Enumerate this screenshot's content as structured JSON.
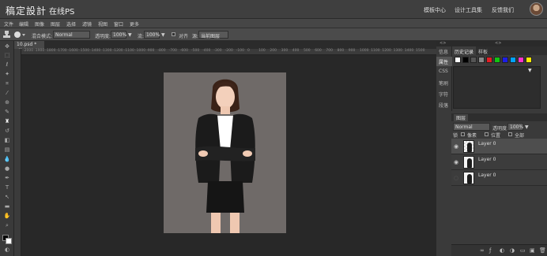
{
  "topbar": {
    "brand": "稿定設計",
    "subtitle": "在线PS",
    "links": [
      "模板中心",
      "设计工具集",
      "反馈我们"
    ]
  },
  "menu": [
    "文件",
    "编辑",
    "图像",
    "图层",
    "选择",
    "滤镜",
    "视图",
    "窗口",
    "更多"
  ],
  "options": {
    "blend_label": "混合模式:",
    "blend_value": "Normal",
    "opacity_label": "透明度:",
    "opacity_value": "100%",
    "flow_label": "流:",
    "flow_value": "100%",
    "align_label": "对齐",
    "sample_label": "源:",
    "sample_value": "当前图层"
  },
  "document": {
    "tab_title": "10.psd *"
  },
  "ruler": [
    "-2000",
    "-1900",
    "-1800",
    "-1700",
    "-1600",
    "-1500",
    "-1400",
    "-1300",
    "-1200",
    "-1100",
    "-1000",
    "-900",
    "-800",
    "-700",
    "-600",
    "-500",
    "-400",
    "-300",
    "-200",
    "-100",
    "0",
    "100",
    "200",
    "300",
    "400",
    "500",
    "600",
    "700",
    "800",
    "900",
    "1000",
    "1100",
    "1200",
    "1300",
    "1400",
    "1500"
  ],
  "right_panel": {
    "side_tabs": [
      "信息",
      "属性",
      "CSS",
      "笔刷",
      "字符",
      "段落"
    ],
    "history_tabs": [
      "历史记录",
      "样板"
    ],
    "swatches": [
      "#ffffff",
      "#000000",
      "#555555",
      "#888888",
      "#e51c23",
      "#12c312",
      "#1d1de6",
      "#00a2ff",
      "#ff33cc",
      "#ffea00"
    ],
    "layers_title": "图层",
    "layer_blend": "Normal",
    "layer_opacity_label": "透明度:",
    "layer_opacity_value": "100%",
    "lock_label": "锁",
    "lock_options": [
      "像素",
      "位置",
      "全部"
    ],
    "layers": [
      {
        "name": "Layer 0",
        "visible": true
      },
      {
        "name": "Layer 0",
        "visible": true
      },
      {
        "name": "Layer 0",
        "visible": false
      }
    ],
    "footer_icons": [
      "link-icon",
      "fx-icon",
      "mask-icon",
      "adjustment-icon",
      "folder-icon",
      "new-layer-icon",
      "delete-icon"
    ]
  }
}
